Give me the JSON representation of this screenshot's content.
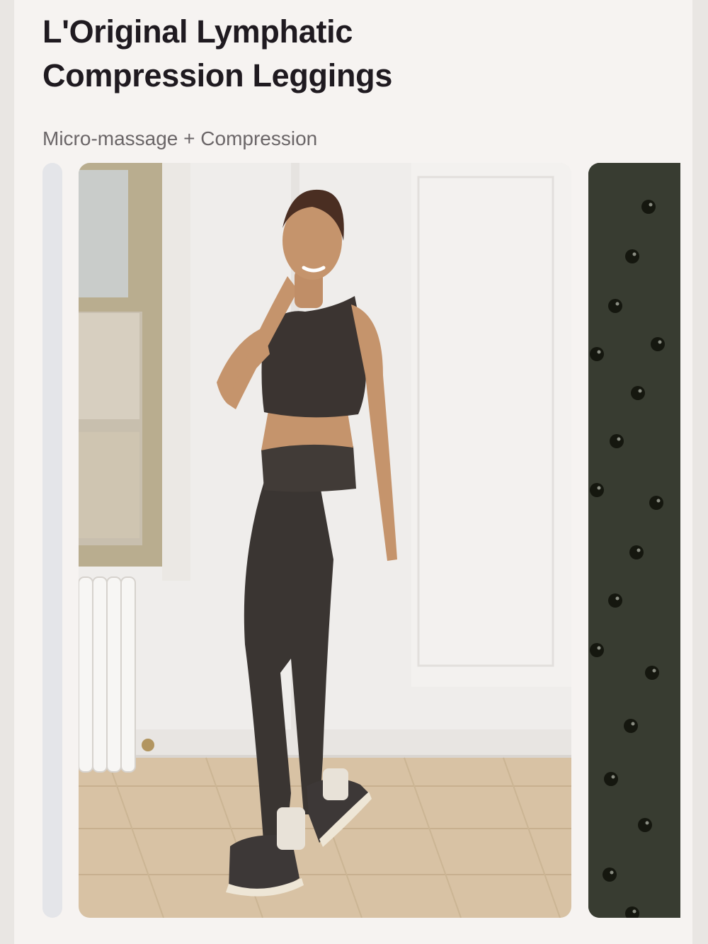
{
  "product": {
    "title_line1": "L'Original Lymphatic",
    "title_line2": "Compression Leggings",
    "subtitle": "Micro-massage + Compression"
  },
  "carousel": {
    "slides": [
      {
        "id": "previous-slide",
        "kind": "partial"
      },
      {
        "id": "lifestyle-photo",
        "kind": "photo"
      },
      {
        "id": "fabric-closeup",
        "kind": "partial"
      }
    ]
  },
  "colors": {
    "page_background": "#f6f3f1",
    "title_text": "#1f1a20",
    "subtitle_text": "#6b6668",
    "fabric": "#383c31",
    "garment": "#3a3532"
  }
}
